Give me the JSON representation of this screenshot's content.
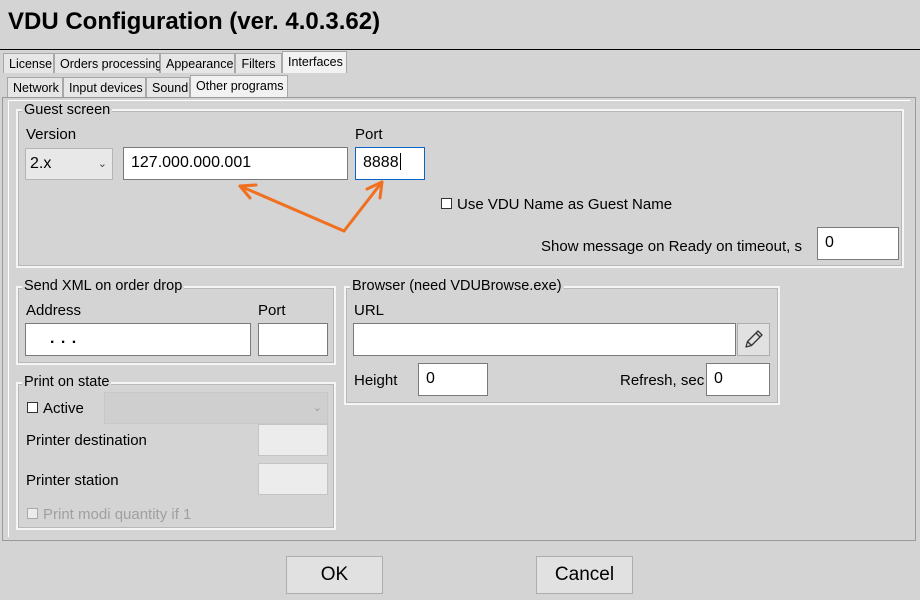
{
  "window": {
    "title": "VDU Configuration (ver. 4.0.3.62)"
  },
  "tabs_main": [
    {
      "label": "License"
    },
    {
      "label": "Orders processing"
    },
    {
      "label": "Appearance"
    },
    {
      "label": "Filters"
    },
    {
      "label": "Interfaces"
    }
  ],
  "tabs_sub": [
    {
      "label": "Network"
    },
    {
      "label": "Input devices"
    },
    {
      "label": "Sound"
    },
    {
      "label": "Other programs"
    }
  ],
  "guest_screen": {
    "legend": "Guest screen",
    "version_label": "Version",
    "version_value": "2.x",
    "address_value": "127.000.000.001",
    "port_label": "Port",
    "port_value": "8888",
    "use_vdu_name_label": "Use VDU Name as Guest Name",
    "show_message_label": "Show message on Ready on timeout, s",
    "show_message_value": "0"
  },
  "send_xml": {
    "legend": "Send XML on order drop",
    "address_label": "Address",
    "address_value": ".   .   .",
    "port_label": "Port",
    "port_value": ""
  },
  "browser": {
    "legend": "Browser (need VDUBrowse.exe)",
    "url_label": "URL",
    "url_value": "",
    "height_label": "Height",
    "height_value": "0",
    "refresh_label": "Refresh, sec",
    "refresh_value": "0"
  },
  "print_on_state": {
    "legend": "Print on state",
    "active_label": "Active",
    "printer_destination_label": "Printer destination",
    "printer_station_label": "Printer station",
    "print_modi_label": "Print modi quantity if 1"
  },
  "buttons": {
    "ok": "OK",
    "cancel": "Cancel"
  },
  "colors": {
    "annotation_arrow": "#f07020",
    "focus_border": "#0a64c8"
  }
}
